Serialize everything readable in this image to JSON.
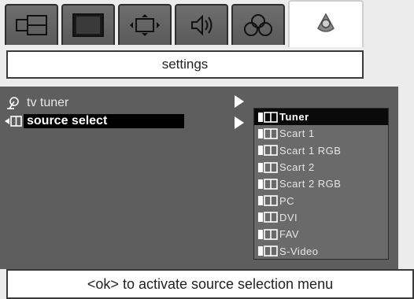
{
  "tabs": [
    {
      "icon": "picture-in-picture-icon"
    },
    {
      "icon": "screen-icon"
    },
    {
      "icon": "picture-format-icon"
    },
    {
      "icon": "sound-icon"
    },
    {
      "icon": "features-icon"
    },
    {
      "icon": "settings-icon",
      "active": true
    }
  ],
  "header": {
    "title": "settings"
  },
  "menu": [
    {
      "label": "tv tuner",
      "icon": "antenna-icon",
      "selected": false
    },
    {
      "label": "source select",
      "icon": "source-select-icon",
      "selected": true
    }
  ],
  "submenu": {
    "items": [
      {
        "label": "Tuner",
        "selected": true
      },
      {
        "label": "Scart 1"
      },
      {
        "label": "Scart 1 RGB"
      },
      {
        "label": "Scart 2"
      },
      {
        "label": "Scart 2 RGB"
      },
      {
        "label": "PC"
      },
      {
        "label": "DVI"
      },
      {
        "label": "FAV"
      },
      {
        "label": "S-Video"
      }
    ]
  },
  "footer": {
    "hint": "<ok> to activate source selection menu"
  },
  "colors": {
    "panel": "#5e5e5e",
    "selection": "#000000",
    "tab": "#666666"
  }
}
